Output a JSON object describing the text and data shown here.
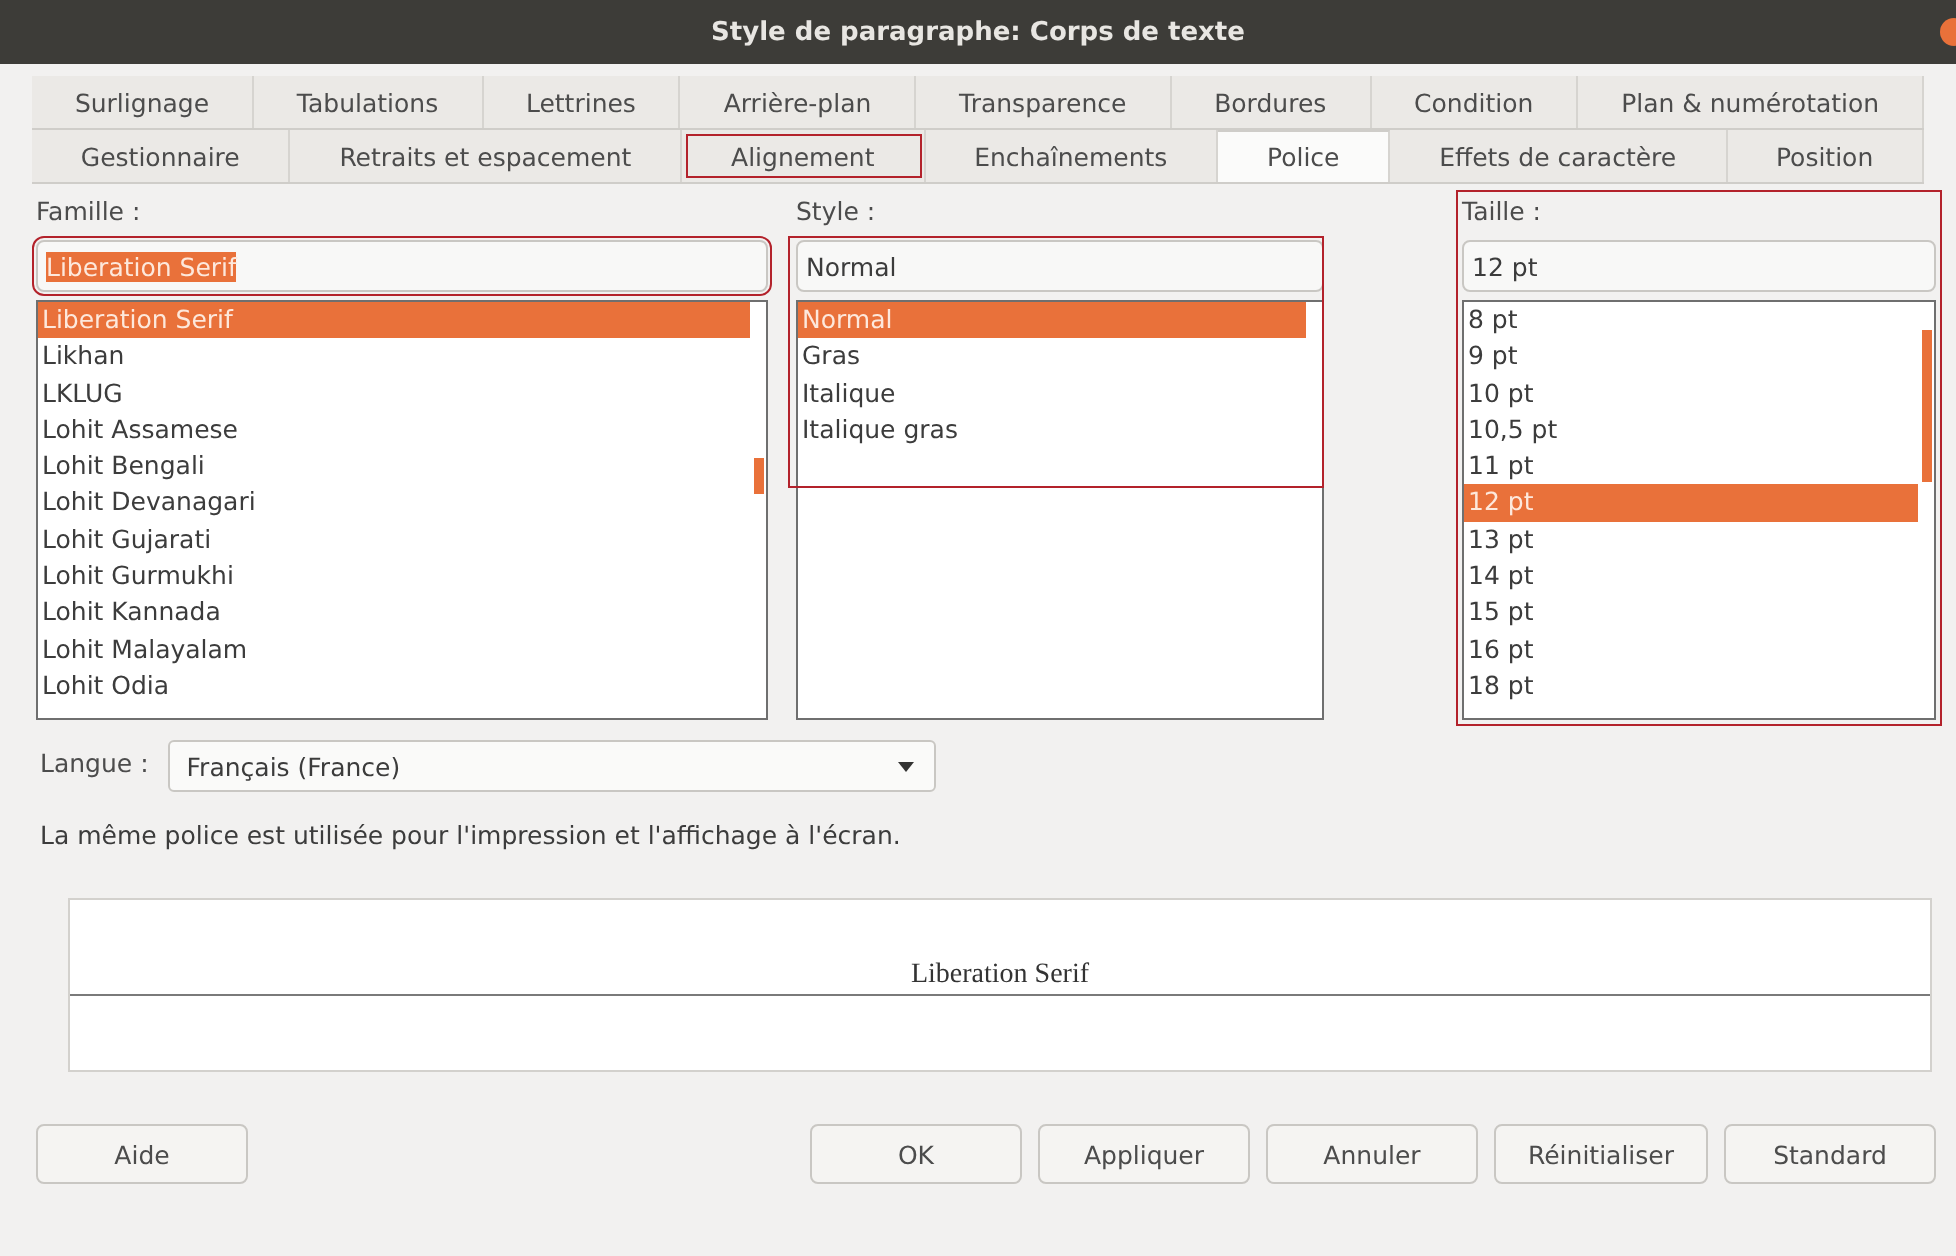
{
  "window": {
    "title": "Style de paragraphe: Corps de texte"
  },
  "tab_rows": [
    [
      {
        "label": "Surlignage",
        "selected": false,
        "highlighted": false
      },
      {
        "label": "Tabulations",
        "selected": false,
        "highlighted": false
      },
      {
        "label": "Lettrines",
        "selected": false,
        "highlighted": false
      },
      {
        "label": "Arrière-plan",
        "selected": false,
        "highlighted": false
      },
      {
        "label": "Transparence",
        "selected": false,
        "highlighted": false
      },
      {
        "label": "Bordures",
        "selected": false,
        "highlighted": false
      },
      {
        "label": "Condition",
        "selected": false,
        "highlighted": false
      },
      {
        "label": "Plan & numérotation",
        "selected": false,
        "highlighted": false
      }
    ],
    [
      {
        "label": "Gestionnaire",
        "selected": false,
        "highlighted": false
      },
      {
        "label": "Retraits et espacement",
        "selected": false,
        "highlighted": false
      },
      {
        "label": "Alignement",
        "selected": false,
        "highlighted": true
      },
      {
        "label": "Enchaînements",
        "selected": false,
        "highlighted": false
      },
      {
        "label": "Police",
        "selected": true,
        "highlighted": false
      },
      {
        "label": "Effets de caractère",
        "selected": false,
        "highlighted": false
      },
      {
        "label": "Position",
        "selected": false,
        "highlighted": false
      }
    ]
  ],
  "columns": [
    {
      "label": "Famille :",
      "value": "Liberation Serif",
      "value_selected": true,
      "field_highlighted": true,
      "list_highlighted": false,
      "column_highlighted": false,
      "items": [
        {
          "label": "Liberation Serif",
          "selected": true
        },
        {
          "label": "Likhan",
          "selected": false
        },
        {
          "label": "LKLUG",
          "selected": false
        },
        {
          "label": "Lohit Assamese",
          "selected": false
        },
        {
          "label": "Lohit Bengali",
          "selected": false
        },
        {
          "label": "Lohit Devanagari",
          "selected": false
        },
        {
          "label": "Lohit Gujarati",
          "selected": false
        },
        {
          "label": "Lohit Gurmukhi",
          "selected": false
        },
        {
          "label": "Lohit Kannada",
          "selected": false
        },
        {
          "label": "Lohit Malayalam",
          "selected": false
        },
        {
          "label": "Lohit Odia",
          "selected": false
        }
      ]
    },
    {
      "label": "Style :",
      "value": "Normal",
      "value_selected": false,
      "field_highlighted": false,
      "list_highlighted": true,
      "column_highlighted": false,
      "items": [
        {
          "label": "Normal",
          "selected": true
        },
        {
          "label": "Gras",
          "selected": false
        },
        {
          "label": "Italique",
          "selected": false
        },
        {
          "label": "Italique gras",
          "selected": false
        }
      ]
    },
    {
      "label": "Taille :",
      "value": "12 pt",
      "value_selected": false,
      "field_highlighted": false,
      "list_highlighted": false,
      "column_highlighted": true,
      "items": [
        {
          "label": "8 pt",
          "selected": false
        },
        {
          "label": "9 pt",
          "selected": false
        },
        {
          "label": "10 pt",
          "selected": false
        },
        {
          "label": "10,5 pt",
          "selected": false
        },
        {
          "label": "11 pt",
          "selected": false
        },
        {
          "label": "12 pt",
          "selected": true
        },
        {
          "label": "13 pt",
          "selected": false
        },
        {
          "label": "14 pt",
          "selected": false
        },
        {
          "label": "15 pt",
          "selected": false
        },
        {
          "label": "16 pt",
          "selected": false
        },
        {
          "label": "18 pt",
          "selected": false
        }
      ]
    }
  ],
  "language": {
    "label": "Langue :",
    "value": "Français (France)"
  },
  "note": "La même police est utilisée pour l'impression et l'affichage à l'écran.",
  "preview": {
    "text": "Liberation Serif"
  },
  "buttons": [
    {
      "label": "Aide",
      "kind": "left"
    },
    {
      "label": "OK",
      "kind": "right"
    },
    {
      "label": "Appliquer",
      "kind": "right"
    },
    {
      "label": "Annuler",
      "kind": "right"
    },
    {
      "label": "Réinitialiser",
      "kind": "right"
    },
    {
      "label": "Standard",
      "kind": "right"
    }
  ]
}
